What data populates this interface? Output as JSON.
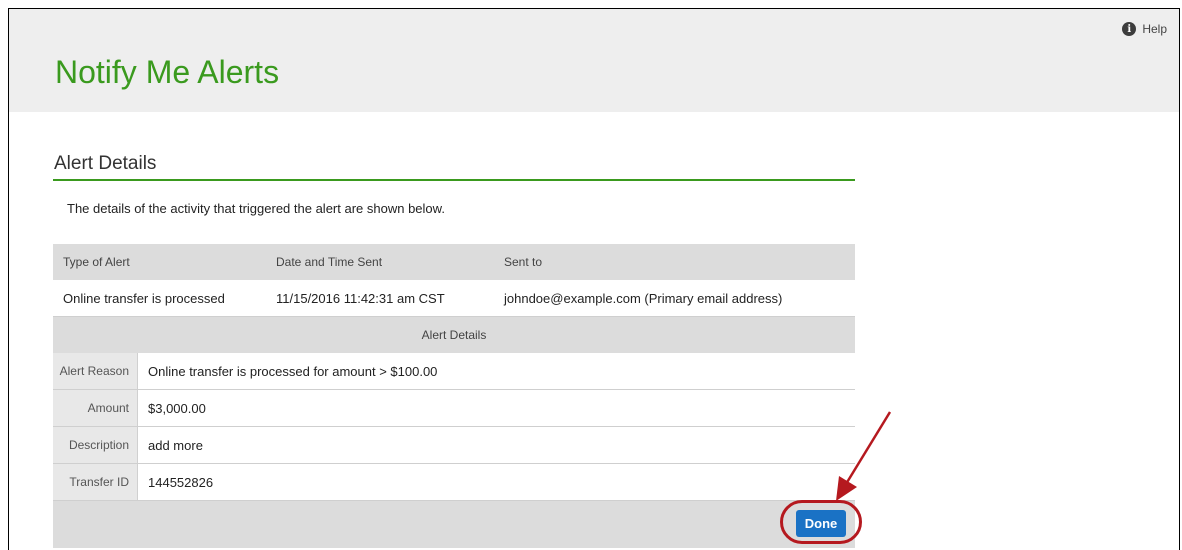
{
  "header": {
    "help_label": "Help",
    "title": "Notify Me Alerts"
  },
  "section": {
    "title": "Alert Details",
    "intro": "The details of the activity that triggered the alert are shown below."
  },
  "table": {
    "columns": [
      "Type of Alert",
      "Date and Time Sent",
      "Sent to"
    ],
    "row": [
      "Online transfer is processed",
      "11/15/2016 11:42:31 am CST",
      "johndoe@example.com (Primary email address)"
    ],
    "details_header": "Alert Details",
    "details": [
      {
        "label": "Alert Reason",
        "value": "Online transfer is processed for amount > $100.00"
      },
      {
        "label": "Amount",
        "value": "$3,000.00"
      },
      {
        "label": "Description",
        "value": "add more"
      },
      {
        "label": "Transfer ID",
        "value": "144552826"
      }
    ]
  },
  "actions": {
    "done_label": "Done"
  },
  "colors": {
    "accent_green": "#3a9a1e",
    "button_blue": "#1a72c5",
    "annotation_red": "#b5191f"
  }
}
